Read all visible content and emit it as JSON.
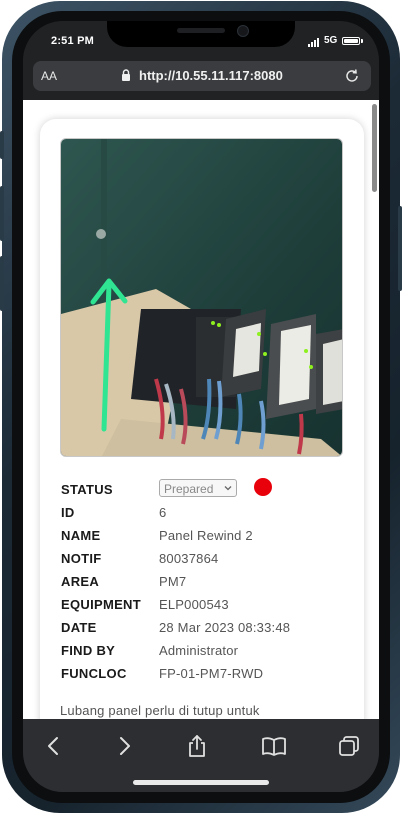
{
  "status_bar": {
    "time": "2:51 PM",
    "network": "5G"
  },
  "browser": {
    "text_size_label": "AA",
    "url": "http://10.55.11.117:8080"
  },
  "detail": {
    "fields": [
      {
        "label": "STATUS",
        "value": "Prepared"
      },
      {
        "label": "ID",
        "value": "6"
      },
      {
        "label": "NAME",
        "value": "Panel Rewind 2"
      },
      {
        "label": "NOTIF",
        "value": "80037864"
      },
      {
        "label": "AREA",
        "value": "PM7"
      },
      {
        "label": "EQUIPMENT",
        "value": "ELP000543"
      },
      {
        "label": "DATE",
        "value": "28 Mar 2023 08:33:48"
      },
      {
        "label": "FIND BY",
        "value": "Administrator"
      },
      {
        "label": "FUNCLOC",
        "value": "FP-01-PM7-RWD"
      }
    ],
    "status_indicator_color": "#e8000b",
    "description": "Lubang panel perlu di tutup untuk"
  },
  "toolbar": {
    "icons": [
      "back-icon",
      "forward-icon",
      "share-icon",
      "bookmarks-icon",
      "tabs-icon"
    ]
  }
}
